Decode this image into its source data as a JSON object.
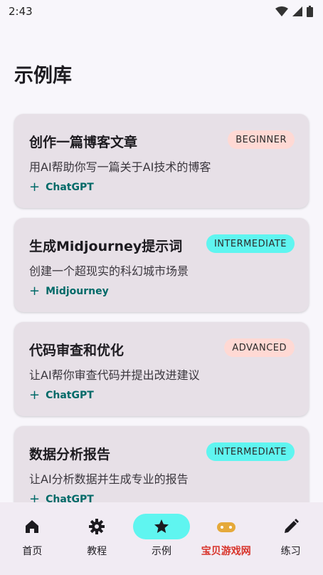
{
  "status": {
    "time": "2:43"
  },
  "page": {
    "title": "示例库"
  },
  "examples": [
    {
      "title": "创作一篇博客文章",
      "level": "BEGINNER",
      "description": "用AI帮助你写一篇关于AI技术的博客",
      "tool": "ChatGPT",
      "level_color": "#ffd9d4"
    },
    {
      "title": "生成Midjourney提示词",
      "level": "INTERMEDIATE",
      "description": "创建一个超现实的科幻城市场景",
      "tool": "Midjourney",
      "level_color": "#5ff5f0"
    },
    {
      "title": "代码审查和优化",
      "level": "ADVANCED",
      "description": "让AI帮你审查代码并提出改进建议",
      "tool": "ChatGPT",
      "level_color": "#ffd9d4"
    },
    {
      "title": "数据分析报告",
      "level": "INTERMEDIATE",
      "description": "让AI分析数据并生成专业的报告",
      "tool": "ChatGPT",
      "level_color": "#5ff5f0"
    }
  ],
  "nav": {
    "items": [
      {
        "label": "首页",
        "icon": "home-icon"
      },
      {
        "label": "教程",
        "icon": "gear-icon"
      },
      {
        "label": "示例",
        "icon": "star-icon",
        "active": true
      },
      {
        "label": "宝贝游戏网",
        "icon": "gamepad-icon"
      },
      {
        "label": "练习",
        "icon": "pencil-icon"
      }
    ]
  },
  "colors": {
    "accent": "#5ff5f0",
    "tag": "#006a68",
    "card": "#e7e0e7"
  }
}
